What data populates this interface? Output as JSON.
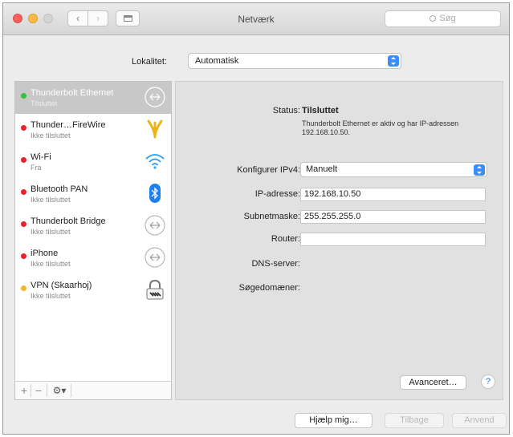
{
  "window": {
    "title": "Netværk",
    "search_placeholder": "Søg",
    "back_glyph": "‹",
    "forward_glyph": "›"
  },
  "location": {
    "label": "Lokalitet:",
    "value": "Automatisk"
  },
  "services": [
    {
      "name": "Thunderbolt Ethernet",
      "status": "Tilsluttet",
      "dot": "green",
      "icon": "arrows-icon",
      "selected": true
    },
    {
      "name": "Thunder…FireWire",
      "status": "Ikke tilsluttet",
      "dot": "red",
      "icon": "firewire-icon"
    },
    {
      "name": "Wi-Fi",
      "status": "Fra",
      "dot": "red",
      "icon": "wifi-icon"
    },
    {
      "name": "Bluetooth PAN",
      "status": "Ikke tilsluttet",
      "dot": "red",
      "icon": "bluetooth-icon"
    },
    {
      "name": "Thunderbolt Bridge",
      "status": "Ikke tilsluttet",
      "dot": "red",
      "icon": "arrows-icon"
    },
    {
      "name": "iPhone",
      "status": "Ikke tilsluttet",
      "dot": "red",
      "icon": "arrows-icon"
    },
    {
      "name": "VPN (Skaarhoj)",
      "status": "Ikke tilsluttet",
      "dot": "yellow",
      "icon": "vpn-lock-icon"
    }
  ],
  "sidebar_bottom": {
    "add": "+",
    "remove": "−",
    "gear": "⚙▾"
  },
  "details": {
    "status_label": "Status:",
    "status_value": "Tilsluttet",
    "status_description": "Thunderbolt Ethernet er aktiv og har IP-adressen 192.168.10.50.",
    "configure_label": "Konfigurer IPv4:",
    "configure_value": "Manuelt",
    "ip_label": "IP-adresse:",
    "ip_value": "192.168.10.50",
    "subnet_label": "Subnetmaske:",
    "subnet_value": "255.255.255.0",
    "router_label": "Router:",
    "router_value": "",
    "dns_label": "DNS-server:",
    "dns_value": "",
    "search_domains_label": "Søgedomæner:",
    "search_domains_value": "",
    "advanced_button": "Avanceret…",
    "help_glyph": "?"
  },
  "footer": {
    "help_button": "Hjælp mig…",
    "revert_button": "Tilbage",
    "apply_button": "Anvend"
  },
  "colors": {
    "accent": "#3c8dfc",
    "status_green": "#32c13a",
    "status_red": "#e2242c",
    "status_yellow": "#f4b52e"
  }
}
